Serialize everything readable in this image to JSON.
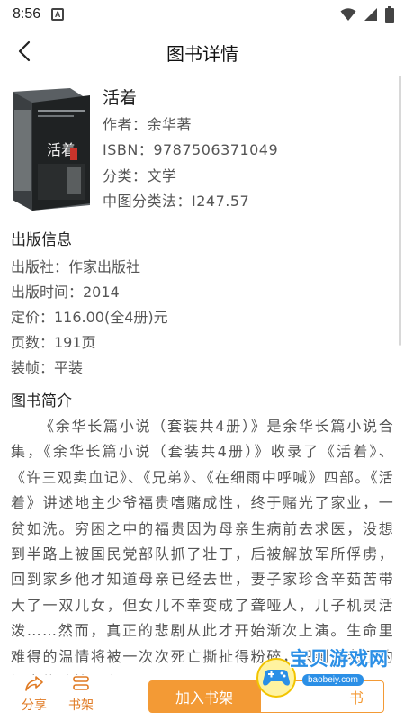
{
  "status_bar": {
    "time": "8:56",
    "badge": "A"
  },
  "header": {
    "title": "图书详情"
  },
  "book": {
    "title": "活着",
    "author": "作者：余华著",
    "isbn": "ISBN：9787506371049",
    "category": "分类：文学",
    "clc": "中图分类法：I247.57",
    "cover_text": "活着"
  },
  "publication": {
    "heading": "出版信息",
    "lines": [
      "出版社：作家出版社",
      "出版时间：2014",
      "定价：116.00(全4册)元",
      "页数：191页",
      "装帧：平装"
    ]
  },
  "intro": {
    "heading": "图书简介",
    "text": "《余华长篇小说（套装共4册）》是余华长篇小说合集，《余华长篇小说（套装共4册）》收录了《活着》、《许三观卖血记》、《兄弟》、《在细雨中呼喊》四部。《活着》讲述地主少爷福贵嗜赌成性，终于赌光了家业，一贫如洗。穷困之中的福贵因为母亲生病前去求医，没想到半路上被国民党部队抓了壮丁，后被解放军所俘虏，回到家乡他才知道母亲已经去世，妻子家珍含辛茹苦带大了一双儿女，但女儿不幸变成了聋哑人，儿子机灵活泼……然而，真正的悲剧从此才开始渐次上演。生命里难得的温情将被一次次死亡撕扯得粉碎，只剩得老了的福贵伴随着一头"
  },
  "bottom_bar": {
    "share_label": "分享",
    "shelf_label": "书架",
    "add_to_shelf": "加入书架",
    "read_label": "书"
  },
  "watermark": {
    "name": "宝贝游戏网",
    "url": "baobeiy.com"
  },
  "colors": {
    "accent": "#f39a35",
    "label": "#e07a23",
    "watermark": "#2b8fe6"
  },
  "icons": [
    "back-arrow-icon",
    "share-icon",
    "bookshelf-icon",
    "wifi-icon",
    "signal-icon",
    "battery-icon"
  ]
}
